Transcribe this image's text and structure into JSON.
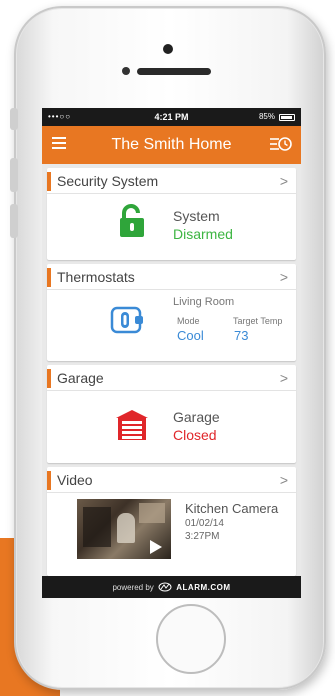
{
  "status_bar": {
    "signal": "•••○○",
    "time": "4:21 PM",
    "battery": "85%"
  },
  "header": {
    "title": "The Smith Home"
  },
  "cards": {
    "security": {
      "title": "Security System",
      "label": "System",
      "status": "Disarmed"
    },
    "thermostats": {
      "title": "Thermostats",
      "location": "Living Room",
      "mode_label": "Mode",
      "mode_value": "Cool",
      "target_label": "Target Temp",
      "target_value": "73"
    },
    "garage": {
      "title": "Garage",
      "label": "Garage",
      "status": "Closed"
    },
    "video": {
      "title": "Video",
      "camera_name": "Kitchen Camera",
      "date": "01/02/14",
      "time": "3:27PM"
    }
  },
  "footer": {
    "prefix": "powered by",
    "brand": "ALARM.COM"
  },
  "colors": {
    "accent": "#e87722",
    "ok": "#3db542",
    "alert": "#e0262a",
    "info": "#3a8ad6"
  }
}
